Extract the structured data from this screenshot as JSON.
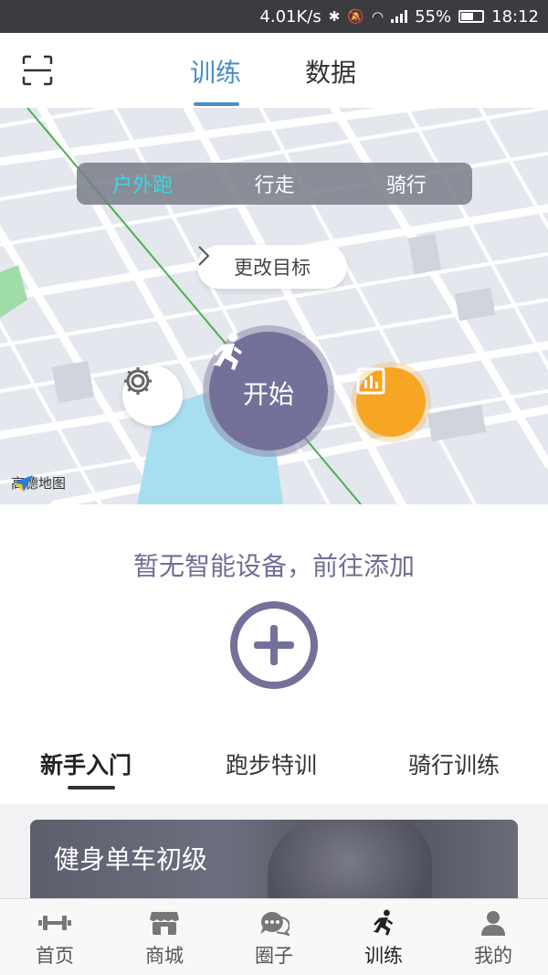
{
  "status_bar": {
    "speed": "4.01K/s",
    "battery": "55%",
    "time": "18:12"
  },
  "header": {
    "tabs": [
      {
        "label": "训练"
      },
      {
        "label": "数据"
      }
    ]
  },
  "map": {
    "modes": [
      {
        "label": "户外跑"
      },
      {
        "label": "行走"
      },
      {
        "label": "骑行"
      }
    ],
    "goal_label": "更改目标",
    "start_label": "开始",
    "map_provider": "高德地图"
  },
  "device": {
    "text": "暂无智能设备，前往添加"
  },
  "courses": {
    "tabs": [
      {
        "label": "新手入门"
      },
      {
        "label": "跑步特训"
      },
      {
        "label": "骑行训练"
      }
    ],
    "card_title": "健身单车初级"
  },
  "bottom_nav": [
    {
      "label": "首页",
      "icon": "dumbbell-icon"
    },
    {
      "label": "商城",
      "icon": "shop-icon"
    },
    {
      "label": "圈子",
      "icon": "chat-icon"
    },
    {
      "label": "训练",
      "icon": "runner-icon"
    },
    {
      "label": "我的",
      "icon": "person-icon"
    }
  ],
  "colors": {
    "accent": "#4a8ec5",
    "primary": "#737199",
    "active_mode": "#3ad8e6",
    "stats": "#f6a623"
  }
}
